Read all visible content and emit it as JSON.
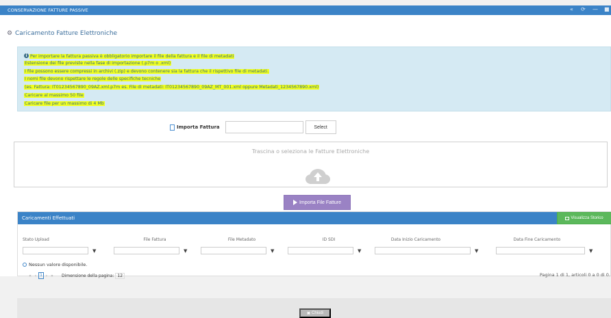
{
  "window": {
    "title": "CONSERVAZIONE FATTURE PASSIVE",
    "controls": [
      "«",
      "⟳",
      "—",
      "■"
    ]
  },
  "page": {
    "title": "Caricamento Fatture Elettroniche"
  },
  "info": {
    "lines": [
      "Per importare la fattura passiva è obbligatorio importare il file della fattura e il file di metadati",
      "Estensione dei file previste nella fase di importazione (.p7m o .xml)",
      "I file possono essere compressi in archivi (.zip) e devono contenere sia la fattura che il rispettivo file di metadati.",
      "I nomi file devono rispettare le regole delle specifiche tecniche",
      "(es. Fattura: IT01234567890_09AZ.xml.p7m es. File di metadati: IT01234567890_09AZ_MT_001.xml oppure Metadati_1234567890.xml)",
      "Caricare al massimo 50 file",
      "Caricare file per un massimo di 4 Mb"
    ]
  },
  "import": {
    "label": "Importa Fattura",
    "input_value": "",
    "select_label": "Select"
  },
  "dropzone": {
    "text": "Trascina o seleziona le Fatture Elettroniche"
  },
  "import_button": {
    "label": "Importa File Fatture"
  },
  "loads": {
    "title": "Caricamenti Effettuati",
    "storico_label": "Visualizza Storico",
    "columns": [
      "Stato Upload",
      "File Fattura",
      "File Metadato",
      "ID SDI",
      "Data Inizio Caricamento",
      "Data Fine Caricamento"
    ],
    "empty_text": "Nessun valore disponibile.",
    "pager": {
      "first": "«",
      "prev": "‹",
      "current": "1",
      "next": "›",
      "last": "»",
      "page_size_label": "Dimensione della pagina:",
      "page_size": "12",
      "info": "Pagina 1 di 1, articoli 0 a 0 di 0."
    }
  },
  "footer": {
    "close_label": "Chiudi"
  },
  "colors": {
    "header_blue": "#3b83c7",
    "info_bg": "#d5eaf3",
    "highlight": "#f0ff1e",
    "import_purple": "#9a82c4",
    "storico_green": "#5cb85c"
  }
}
